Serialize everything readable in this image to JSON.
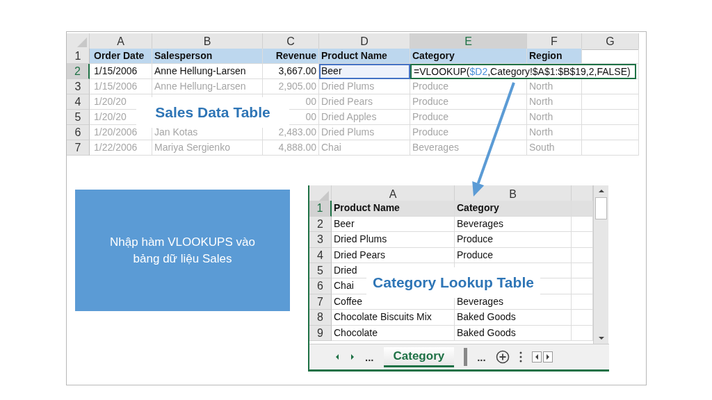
{
  "sales_sheet": {
    "columns": [
      {
        "label": "A",
        "selected": false
      },
      {
        "label": "B",
        "selected": false
      },
      {
        "label": "C",
        "selected": false
      },
      {
        "label": "D",
        "selected": false
      },
      {
        "label": "E",
        "selected": true
      },
      {
        "label": "F",
        "selected": false
      },
      {
        "label": "G",
        "selected": false
      }
    ],
    "rows": [
      {
        "number": "1",
        "kind": "header",
        "selected": false,
        "dimmed": false,
        "order_date": "Order Date",
        "salesperson": "Salesperson",
        "revenue": "Revenue",
        "product_name": "Product Name",
        "category": "Category",
        "region": "Region"
      },
      {
        "number": "2",
        "kind": "data",
        "selected": true,
        "dimmed": false,
        "product_name_referenced": true,
        "order_date": "1/15/2006",
        "salesperson": "Anne Hellung-Larsen",
        "revenue": "3,667.00",
        "product_name": "Beer",
        "formula": {
          "start": "=VLOOKUP(",
          "reference": "$D2",
          "end": ",Category!$A$1:$B$19,2,FALSE)"
        }
      },
      {
        "number": "3",
        "kind": "data",
        "selected": false,
        "dimmed": true,
        "order_date": "1/15/2006",
        "salesperson": "Anne Hellung-Larsen",
        "revenue": "2,905.00",
        "product_name": "Dried Plums",
        "category": "Produce",
        "region": "North"
      },
      {
        "number": "4",
        "kind": "data",
        "selected": false,
        "dimmed": true,
        "order_date": "1/20/20",
        "revenue": "00",
        "product_name": "Dried Pears",
        "category": "Produce",
        "region": "North"
      },
      {
        "number": "5",
        "kind": "data",
        "selected": false,
        "dimmed": true,
        "order_date": "1/20/20",
        "revenue": "00",
        "product_name": "Dried Apples",
        "category": "Produce",
        "region": "North"
      },
      {
        "number": "6",
        "kind": "data",
        "selected": false,
        "dimmed": true,
        "order_date": "1/20/2006",
        "salesperson": "Jan Kotas",
        "revenue": "2,483.00",
        "product_name": "Dried Plums",
        "category": "Produce",
        "region": "North"
      },
      {
        "number": "7",
        "kind": "data",
        "selected": false,
        "dimmed": true,
        "order_date": "1/22/2006",
        "salesperson": "Mariya Sergienko",
        "revenue": "4,888.00",
        "product_name": "Chai",
        "category": "Beverages",
        "region": "South"
      }
    ],
    "label": "Sales Data Table"
  },
  "note_box": {
    "text": "Nhập hàm VLOOKUPS vào bảng dữ liệu Sales"
  },
  "category_sheet": {
    "columns": [
      {
        "label": "A",
        "selected": false
      },
      {
        "label": "B",
        "selected": false
      }
    ],
    "rows": [
      {
        "number": "1",
        "kind": "header",
        "selected": true,
        "product_name": "Product Name",
        "category": "Category"
      },
      {
        "number": "2",
        "kind": "data",
        "selected": false,
        "product_name": "Beer",
        "category": "Beverages"
      },
      {
        "number": "3",
        "kind": "data",
        "selected": false,
        "product_name": "Dried Plums",
        "category": "Produce"
      },
      {
        "number": "4",
        "kind": "data",
        "selected": false,
        "product_name": "Dried Pears",
        "category": "Produce"
      },
      {
        "number": "5",
        "kind": "data",
        "selected": false,
        "product_name": "Dried"
      },
      {
        "number": "6",
        "kind": "data",
        "selected": false,
        "product_name": "Chai"
      },
      {
        "number": "7",
        "kind": "data",
        "selected": false,
        "product_name": "Coffee",
        "category": "Beverages"
      },
      {
        "number": "8",
        "kind": "data",
        "selected": false,
        "product_name": "Chocolate Biscuits Mix",
        "category": "Baked Goods"
      },
      {
        "number": "9",
        "kind": "data",
        "selected": false,
        "product_name": "Chocolate",
        "category": "Baked Goods"
      }
    ],
    "label": "Category Lookup Table",
    "tab_bar": {
      "more_left": "...",
      "tabs": [
        {
          "label": "Category",
          "selected": true
        }
      ],
      "more_right": "..."
    }
  }
}
